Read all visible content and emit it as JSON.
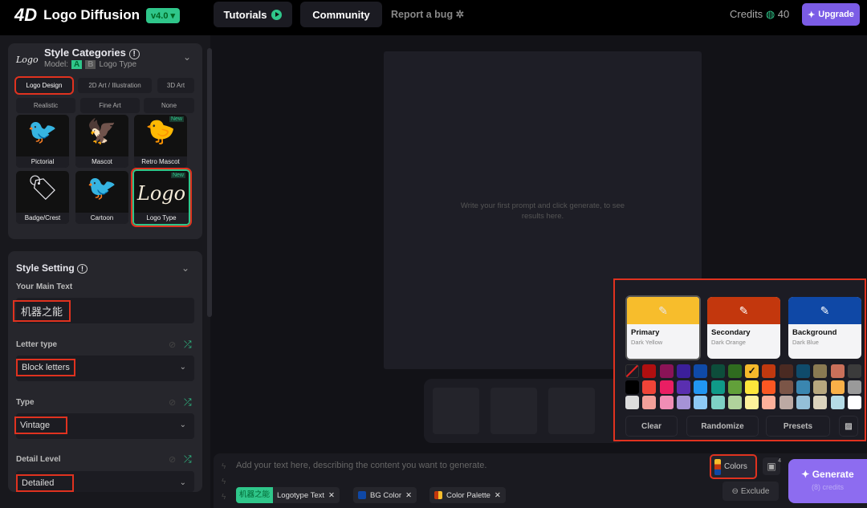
{
  "header": {
    "brand": "Logo Diffusion",
    "version": "v4.0 ▾",
    "tutorials": "Tutorials",
    "community": "Community",
    "report_bug": "Report a bug",
    "credits_label": "Credits",
    "credits": "40",
    "upgrade": "Upgrade"
  },
  "style_categories": {
    "title": "Style Categories",
    "model_label": "Model:",
    "model_a": "A",
    "model_b": "B",
    "model_name": "Logo Type",
    "logo_mark": "Logo",
    "chips": [
      "Logo Design",
      "2D Art / Illustration",
      "3D Art",
      "Realistic",
      "Fine Art",
      "None"
    ],
    "tiles": [
      {
        "label": "Pictorial",
        "art": "🐦"
      },
      {
        "label": "Mascot",
        "art": "🦅"
      },
      {
        "label": "Retro Mascot",
        "art": "🐤",
        "badge": "New"
      },
      {
        "label": "Badge/Crest",
        "art": "🏷"
      },
      {
        "label": "Cartoon",
        "art": "🐦"
      },
      {
        "label": "Logo Type",
        "art": "Logo",
        "badge": "New"
      }
    ]
  },
  "style_setting": {
    "title": "Style Setting",
    "main_text_label": "Your Main Text",
    "main_text": "机器之能",
    "fields": [
      {
        "label": "Letter type",
        "value": "Block letters"
      },
      {
        "label": "Type",
        "value": "Vintage"
      },
      {
        "label": "Detail Level",
        "value": "Detailed"
      }
    ]
  },
  "canvas": {
    "empty_message": "Write your first prompt and click generate, to see results here."
  },
  "colors_panel": {
    "cards": [
      {
        "title": "Primary",
        "name": "Dark Yellow",
        "color": "#f7bd2c"
      },
      {
        "title": "Secondary",
        "name": "Dark Orange",
        "color": "#c3370d"
      },
      {
        "title": "Background",
        "name": "Dark Blue",
        "color": "#0f48a6"
      }
    ],
    "swatches": [
      [
        "none",
        "#b00f10",
        "#8a1357",
        "#3b1f9a",
        "#0f4aa8",
        "#0d4d3b",
        "#2f6b1f",
        "#f6b92b",
        "#c0390f",
        "#4a2a22",
        "#0f4b6b",
        "#8a7a52",
        "#c9705a",
        "#3b3b3b"
      ],
      [
        "#000000",
        "#f04438",
        "#e91e63",
        "#5a2fb0",
        "#2196f3",
        "#0f9a88",
        "#62a03a",
        "#fde63b",
        "#fb5722",
        "#7b5547",
        "#3a86b0",
        "#b8a77e",
        "#f9b048",
        "#9a9a9a"
      ],
      [
        "#dcdcdc",
        "#f3a09a",
        "#f08db5",
        "#a592d6",
        "#8ecaf6",
        "#7ed1c5",
        "#b0d29c",
        "#fdf29b",
        "#fdb09a",
        "#bca9a3",
        "#94bfd8",
        "#dcd3bd",
        "#b5dbe6",
        "#ffffff"
      ]
    ],
    "selected": "#f6b92b",
    "clear": "Clear",
    "randomize": "Randomize",
    "presets": "Presets"
  },
  "prompt": {
    "placeholder": "Add your text here, describing the content you want to generate.",
    "colors": "Colors",
    "image_count": "4",
    "exclude": "Exclude",
    "generate": "Generate",
    "generate_sub": "(8) credits",
    "tags": [
      {
        "chip": "机器之能",
        "label": "Logotype Text"
      },
      {
        "label": "BG Color",
        "color": "#0f48a6"
      },
      {
        "label": "Color Palette"
      }
    ]
  },
  "accent": "#2fc68a",
  "upgrade_color": "#7b5ce6"
}
